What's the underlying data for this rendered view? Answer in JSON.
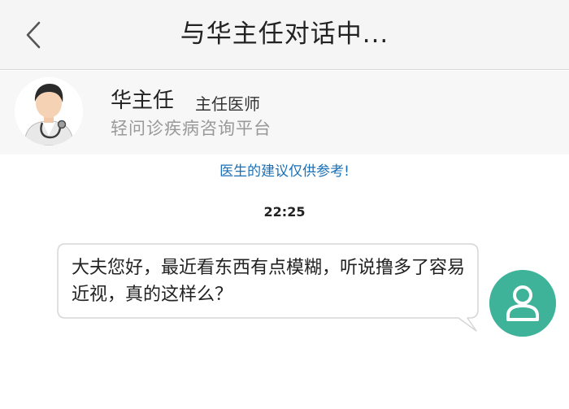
{
  "header": {
    "back_icon": "chevron-left-icon",
    "title": "与华主任对话中..."
  },
  "doctor": {
    "avatar_icon": "doctor-avatar-icon",
    "name": "华主任",
    "title": "主任医师",
    "platform": "轻问诊疾病咨询平台"
  },
  "chat": {
    "notice": "医生的建议仅供参考!",
    "timestamp": "22:25",
    "messages": [
      {
        "sender": "user",
        "text": "大夫您好，最近看东西有点模糊，听说撸多了容易近视，真的这样么？",
        "avatar_icon": "user-avatar-icon"
      }
    ]
  },
  "colors": {
    "topbar_bg": "#f5f5f5",
    "notice": "#1a6fb5",
    "user_avatar_bg": "#3fb39a",
    "bubble_bg": "#ffffff"
  }
}
